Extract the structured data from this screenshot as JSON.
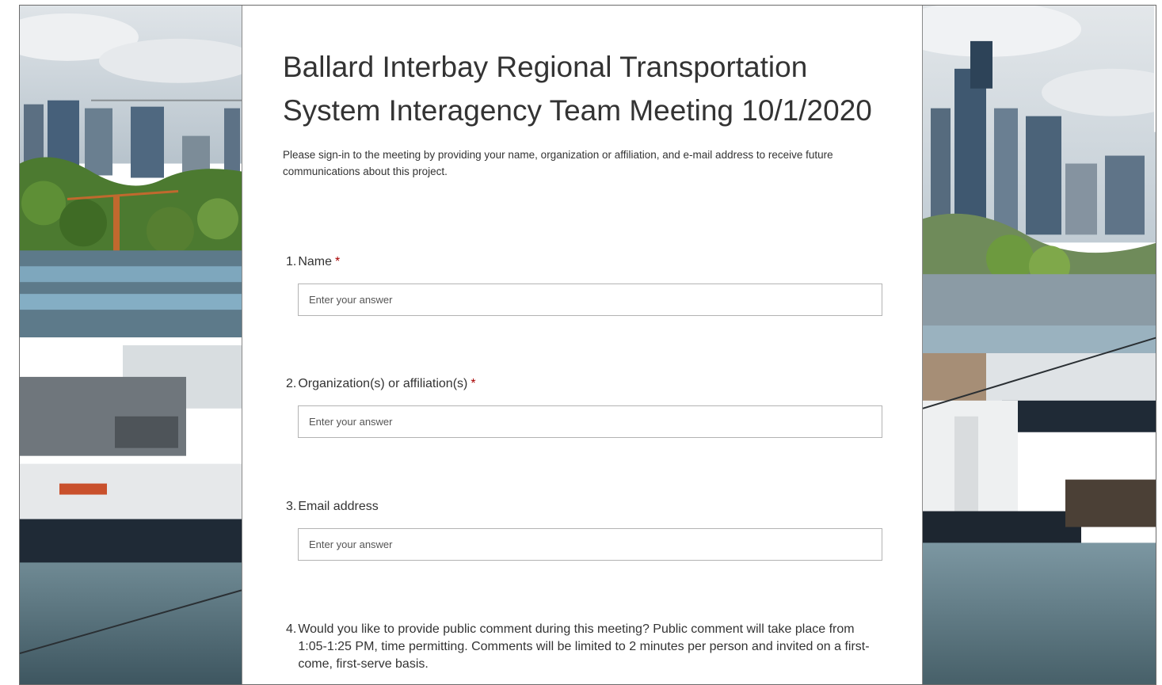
{
  "form": {
    "title": "Ballard Interbay Regional Transportation System Interagency Team Meeting 10/1/2020",
    "description": "Please sign-in to the meeting by providing your name, organization or affiliation, and e-mail address to receive future communications about this project.",
    "questions": [
      {
        "number": "1.",
        "label": "Name",
        "required_mark": "*",
        "placeholder": "Enter your answer"
      },
      {
        "number": "2.",
        "label": "Organization(s) or affiliation(s)",
        "required_mark": "*",
        "placeholder": "Enter your answer"
      },
      {
        "number": "3.",
        "label": "Email address",
        "required_mark": "",
        "placeholder": "Enter your answer"
      },
      {
        "number": "4.",
        "label": "Would you like to provide public comment during this meeting? Public comment will take place from 1:05-1:25 PM, time permitting. Comments will be limited to 2 minutes per person and invited on a first-come, first-serve basis."
      }
    ]
  },
  "colors": {
    "required": "#a80000",
    "text": "#333333",
    "input_border": "#b3b3b3"
  }
}
